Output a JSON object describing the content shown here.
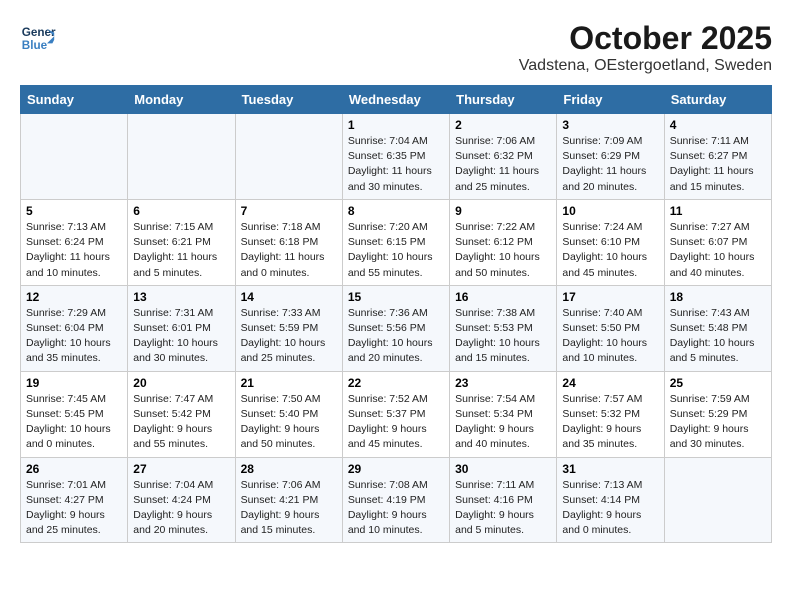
{
  "header": {
    "logo_line1": "General",
    "logo_line2": "Blue",
    "title": "October 2025",
    "subtitle": "Vadstena, OEstergoetland, Sweden"
  },
  "days_of_week": [
    "Sunday",
    "Monday",
    "Tuesday",
    "Wednesday",
    "Thursday",
    "Friday",
    "Saturday"
  ],
  "weeks": [
    [
      {
        "day": "",
        "info": ""
      },
      {
        "day": "",
        "info": ""
      },
      {
        "day": "",
        "info": ""
      },
      {
        "day": "1",
        "info": "Sunrise: 7:04 AM\nSunset: 6:35 PM\nDaylight: 11 hours\nand 30 minutes."
      },
      {
        "day": "2",
        "info": "Sunrise: 7:06 AM\nSunset: 6:32 PM\nDaylight: 11 hours\nand 25 minutes."
      },
      {
        "day": "3",
        "info": "Sunrise: 7:09 AM\nSunset: 6:29 PM\nDaylight: 11 hours\nand 20 minutes."
      },
      {
        "day": "4",
        "info": "Sunrise: 7:11 AM\nSunset: 6:27 PM\nDaylight: 11 hours\nand 15 minutes."
      }
    ],
    [
      {
        "day": "5",
        "info": "Sunrise: 7:13 AM\nSunset: 6:24 PM\nDaylight: 11 hours\nand 10 minutes."
      },
      {
        "day": "6",
        "info": "Sunrise: 7:15 AM\nSunset: 6:21 PM\nDaylight: 11 hours\nand 5 minutes."
      },
      {
        "day": "7",
        "info": "Sunrise: 7:18 AM\nSunset: 6:18 PM\nDaylight: 11 hours\nand 0 minutes."
      },
      {
        "day": "8",
        "info": "Sunrise: 7:20 AM\nSunset: 6:15 PM\nDaylight: 10 hours\nand 55 minutes."
      },
      {
        "day": "9",
        "info": "Sunrise: 7:22 AM\nSunset: 6:12 PM\nDaylight: 10 hours\nand 50 minutes."
      },
      {
        "day": "10",
        "info": "Sunrise: 7:24 AM\nSunset: 6:10 PM\nDaylight: 10 hours\nand 45 minutes."
      },
      {
        "day": "11",
        "info": "Sunrise: 7:27 AM\nSunset: 6:07 PM\nDaylight: 10 hours\nand 40 minutes."
      }
    ],
    [
      {
        "day": "12",
        "info": "Sunrise: 7:29 AM\nSunset: 6:04 PM\nDaylight: 10 hours\nand 35 minutes."
      },
      {
        "day": "13",
        "info": "Sunrise: 7:31 AM\nSunset: 6:01 PM\nDaylight: 10 hours\nand 30 minutes."
      },
      {
        "day": "14",
        "info": "Sunrise: 7:33 AM\nSunset: 5:59 PM\nDaylight: 10 hours\nand 25 minutes."
      },
      {
        "day": "15",
        "info": "Sunrise: 7:36 AM\nSunset: 5:56 PM\nDaylight: 10 hours\nand 20 minutes."
      },
      {
        "day": "16",
        "info": "Sunrise: 7:38 AM\nSunset: 5:53 PM\nDaylight: 10 hours\nand 15 minutes."
      },
      {
        "day": "17",
        "info": "Sunrise: 7:40 AM\nSunset: 5:50 PM\nDaylight: 10 hours\nand 10 minutes."
      },
      {
        "day": "18",
        "info": "Sunrise: 7:43 AM\nSunset: 5:48 PM\nDaylight: 10 hours\nand 5 minutes."
      }
    ],
    [
      {
        "day": "19",
        "info": "Sunrise: 7:45 AM\nSunset: 5:45 PM\nDaylight: 10 hours\nand 0 minutes."
      },
      {
        "day": "20",
        "info": "Sunrise: 7:47 AM\nSunset: 5:42 PM\nDaylight: 9 hours\nand 55 minutes."
      },
      {
        "day": "21",
        "info": "Sunrise: 7:50 AM\nSunset: 5:40 PM\nDaylight: 9 hours\nand 50 minutes."
      },
      {
        "day": "22",
        "info": "Sunrise: 7:52 AM\nSunset: 5:37 PM\nDaylight: 9 hours\nand 45 minutes."
      },
      {
        "day": "23",
        "info": "Sunrise: 7:54 AM\nSunset: 5:34 PM\nDaylight: 9 hours\nand 40 minutes."
      },
      {
        "day": "24",
        "info": "Sunrise: 7:57 AM\nSunset: 5:32 PM\nDaylight: 9 hours\nand 35 minutes."
      },
      {
        "day": "25",
        "info": "Sunrise: 7:59 AM\nSunset: 5:29 PM\nDaylight: 9 hours\nand 30 minutes."
      }
    ],
    [
      {
        "day": "26",
        "info": "Sunrise: 7:01 AM\nSunset: 4:27 PM\nDaylight: 9 hours\nand 25 minutes."
      },
      {
        "day": "27",
        "info": "Sunrise: 7:04 AM\nSunset: 4:24 PM\nDaylight: 9 hours\nand 20 minutes."
      },
      {
        "day": "28",
        "info": "Sunrise: 7:06 AM\nSunset: 4:21 PM\nDaylight: 9 hours\nand 15 minutes."
      },
      {
        "day": "29",
        "info": "Sunrise: 7:08 AM\nSunset: 4:19 PM\nDaylight: 9 hours\nand 10 minutes."
      },
      {
        "day": "30",
        "info": "Sunrise: 7:11 AM\nSunset: 4:16 PM\nDaylight: 9 hours\nand 5 minutes."
      },
      {
        "day": "31",
        "info": "Sunrise: 7:13 AM\nSunset: 4:14 PM\nDaylight: 9 hours\nand 0 minutes."
      },
      {
        "day": "",
        "info": ""
      }
    ]
  ]
}
